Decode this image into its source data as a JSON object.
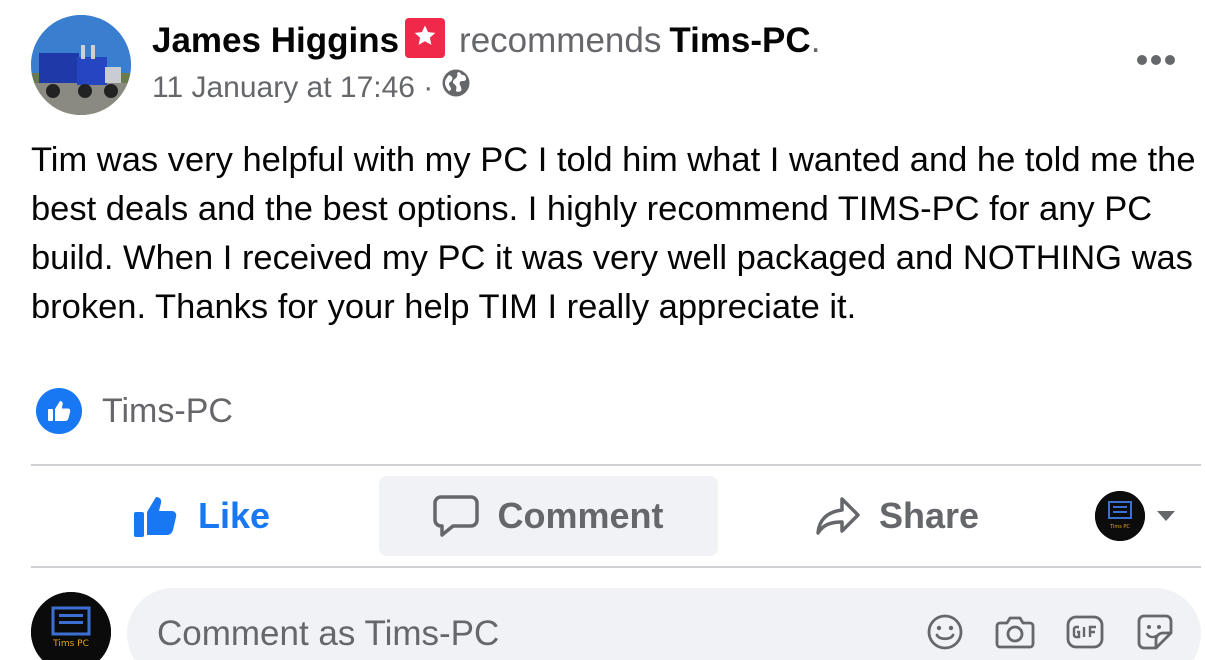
{
  "post": {
    "author": "James Higgins",
    "verb": "recommends",
    "page": "Tims-PC",
    "end_punct": ".",
    "timestamp": "11 January at 17:46 ·",
    "body": "Tim was very helpful with my PC I told him what I wanted and he told me the best deals and the best options. I highly recommend TIMS-PC for any PC build. When I received my PC it was very well packaged and NOTHING was broken. Thanks for your help TIM I really appreciate it."
  },
  "reactions": {
    "names": "Tims-PC",
    "icon": "like-icon"
  },
  "actions": {
    "like": "Like",
    "comment": "Comment",
    "share": "Share"
  },
  "profile": {
    "logo_text": "Tims PC"
  },
  "comment_box": {
    "placeholder": "Comment as Tims-PC"
  },
  "colors": {
    "accent": "#1877f2",
    "secondary_text": "#65676b",
    "badge": "#f02849",
    "input_bg": "#f0f2f5"
  }
}
